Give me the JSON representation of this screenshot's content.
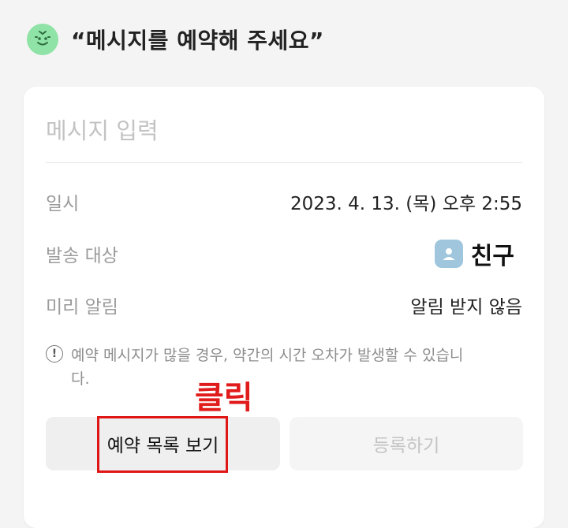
{
  "header": {
    "bot_icon": "smiling-face-icon",
    "title": "“메시지를 예약해 주세요”"
  },
  "form": {
    "message_placeholder": "메시지 입력",
    "rows": [
      {
        "label": "일시",
        "value": "2023. 4. 13. (목) 오후 2:55"
      },
      {
        "label": "발송 대상",
        "value": "친구"
      },
      {
        "label": "미리 알림",
        "value": "알림 받지 않음"
      }
    ],
    "target_icon": "person-icon",
    "notice_icon": "info-icon",
    "notice_text": "예약 메시지가 많을 경우, 약간의 시간 오차가 발생할 수 있습니다."
  },
  "buttons": {
    "list_label": "예약 목록 보기",
    "register_label": "등록하기"
  },
  "annotation": {
    "label": "클릭",
    "color": "#e11b1b"
  }
}
